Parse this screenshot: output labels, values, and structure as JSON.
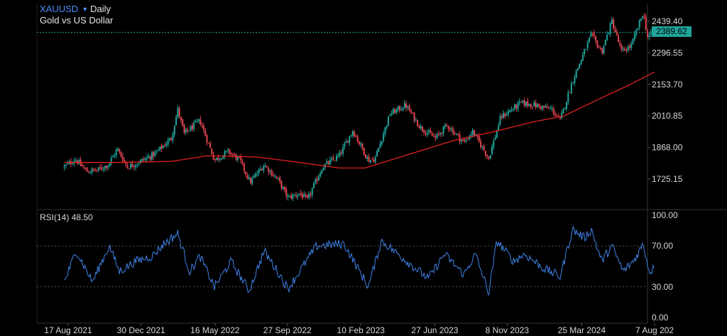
{
  "header": {
    "symbol": "XAUUSD",
    "interval": "Daily",
    "description": "Gold vs US Dollar"
  },
  "indicator": {
    "name": "RSI(14)",
    "value": "48.50"
  },
  "last_price": "2389.62",
  "colors": {
    "background": "#000000",
    "up_candle": "#1fa39a",
    "down_candle": "#e2434f",
    "moving_average": "#e02020",
    "rsi_line": "#3f83e8",
    "price_tag": "#1fa39a",
    "symbol": "#4d8ff7"
  },
  "chart_data": [
    {
      "type": "candlestick",
      "ylim": [
        1650,
        2480
      ],
      "y_ticks": [
        "2439.40",
        "2296.55",
        "2153.70",
        "2010.85",
        "1868.00",
        "1725.15"
      ],
      "x_ticks": [
        "17 Aug 2021",
        "30 Dec 2021",
        "16 May 2022",
        "27 Sep 2022",
        "10 Feb 2023",
        "27 Jun 2023",
        "8 Nov 2023",
        "25 Mar 2024",
        "7 Aug 202"
      ],
      "last_price": 2389.62,
      "close_path": [
        [
          "2021-08-10",
          1780
        ],
        [
          "2021-08-30",
          1815
        ],
        [
          "2021-09-20",
          1760
        ],
        [
          "2021-10-10",
          1765
        ],
        [
          "2021-10-30",
          1790
        ],
        [
          "2021-11-16",
          1860
        ],
        [
          "2021-12-05",
          1780
        ],
        [
          "2021-12-25",
          1800
        ],
        [
          "2022-01-25",
          1840
        ],
        [
          "2022-02-24",
          1910
        ],
        [
          "2022-03-08",
          2040
        ],
        [
          "2022-03-20",
          1930
        ],
        [
          "2022-04-18",
          1990
        ],
        [
          "2022-05-15",
          1810
        ],
        [
          "2022-06-10",
          1850
        ],
        [
          "2022-07-01",
          1810
        ],
        [
          "2022-07-20",
          1710
        ],
        [
          "2022-08-15",
          1790
        ],
        [
          "2022-09-10",
          1720
        ],
        [
          "2022-09-28",
          1640
        ],
        [
          "2022-10-20",
          1660
        ],
        [
          "2022-11-03",
          1630
        ],
        [
          "2022-12-01",
          1780
        ],
        [
          "2023-01-01",
          1830
        ],
        [
          "2023-01-26",
          1945
        ],
        [
          "2023-02-24",
          1810
        ],
        [
          "2023-03-08",
          1815
        ],
        [
          "2023-04-05",
          2020
        ],
        [
          "2023-05-04",
          2060
        ],
        [
          "2023-05-31",
          1960
        ],
        [
          "2023-06-28",
          1910
        ],
        [
          "2023-07-20",
          1970
        ],
        [
          "2023-08-20",
          1890
        ],
        [
          "2023-09-05",
          1940
        ],
        [
          "2023-10-05",
          1820
        ],
        [
          "2023-10-27",
          2005
        ],
        [
          "2023-12-04",
          2070
        ],
        [
          "2023-12-28",
          2060
        ],
        [
          "2024-01-30",
          2040
        ],
        [
          "2024-02-14",
          1990
        ],
        [
          "2024-03-08",
          2170
        ],
        [
          "2024-04-12",
          2380
        ],
        [
          "2024-05-01",
          2300
        ],
        [
          "2024-05-20",
          2440
        ],
        [
          "2024-06-07",
          2300
        ],
        [
          "2024-06-25",
          2330
        ],
        [
          "2024-07-17",
          2480
        ],
        [
          "2024-07-25",
          2370
        ],
        [
          "2024-08-07",
          2389.62
        ]
      ],
      "moving_average": [
        [
          "2021-08-10",
          1800
        ],
        [
          "2021-11-16",
          1800
        ],
        [
          "2022-02-24",
          1805
        ],
        [
          "2022-05-01",
          1830
        ],
        [
          "2022-08-01",
          1825
        ],
        [
          "2022-10-20",
          1800
        ],
        [
          "2023-01-01",
          1775
        ],
        [
          "2023-02-18",
          1775
        ],
        [
          "2023-05-01",
          1830
        ],
        [
          "2023-08-01",
          1900
        ],
        [
          "2023-10-15",
          1940
        ],
        [
          "2023-12-28",
          1985
        ],
        [
          "2024-02-20",
          2010
        ],
        [
          "2024-04-20",
          2080
        ],
        [
          "2024-06-20",
          2150
        ],
        [
          "2024-08-07",
          2210
        ]
      ]
    },
    {
      "type": "line",
      "name": "RSI(14)",
      "ylim": [
        0,
        100
      ],
      "y_ticks": [
        "100.00",
        "70.00",
        "30.00",
        "0.00"
      ],
      "levels": [
        70,
        30
      ],
      "last_value": 48.5,
      "path": [
        [
          "2021-08-10",
          35
        ],
        [
          "2021-09-01",
          65
        ],
        [
          "2021-10-01",
          35
        ],
        [
          "2021-11-01",
          70
        ],
        [
          "2021-11-20",
          45
        ],
        [
          "2021-12-20",
          55
        ],
        [
          "2022-01-20",
          60
        ],
        [
          "2022-02-10",
          72
        ],
        [
          "2022-03-08",
          82
        ],
        [
          "2022-03-30",
          45
        ],
        [
          "2022-04-18",
          60
        ],
        [
          "2022-05-15",
          30
        ],
        [
          "2022-06-15",
          55
        ],
        [
          "2022-07-18",
          26
        ],
        [
          "2022-08-15",
          65
        ],
        [
          "2022-09-15",
          40
        ],
        [
          "2022-09-28",
          28
        ],
        [
          "2022-11-01",
          55
        ],
        [
          "2022-11-20",
          70
        ],
        [
          "2023-01-10",
          72
        ],
        [
          "2023-02-24",
          30
        ],
        [
          "2023-03-20",
          75
        ],
        [
          "2023-04-20",
          62
        ],
        [
          "2023-06-15",
          38
        ],
        [
          "2023-07-15",
          62
        ],
        [
          "2023-08-20",
          42
        ],
        [
          "2023-09-10",
          62
        ],
        [
          "2023-10-05",
          24
        ],
        [
          "2023-10-20",
          75
        ],
        [
          "2023-11-20",
          55
        ],
        [
          "2023-12-10",
          62
        ],
        [
          "2024-01-15",
          48
        ],
        [
          "2024-02-14",
          40
        ],
        [
          "2024-03-08",
          86
        ],
        [
          "2024-03-30",
          78
        ],
        [
          "2024-04-12",
          86
        ],
        [
          "2024-05-01",
          55
        ],
        [
          "2024-05-20",
          70
        ],
        [
          "2024-06-10",
          45
        ],
        [
          "2024-06-30",
          56
        ],
        [
          "2024-07-17",
          72
        ],
        [
          "2024-07-28",
          45
        ],
        [
          "2024-08-07",
          48.5
        ]
      ]
    }
  ]
}
